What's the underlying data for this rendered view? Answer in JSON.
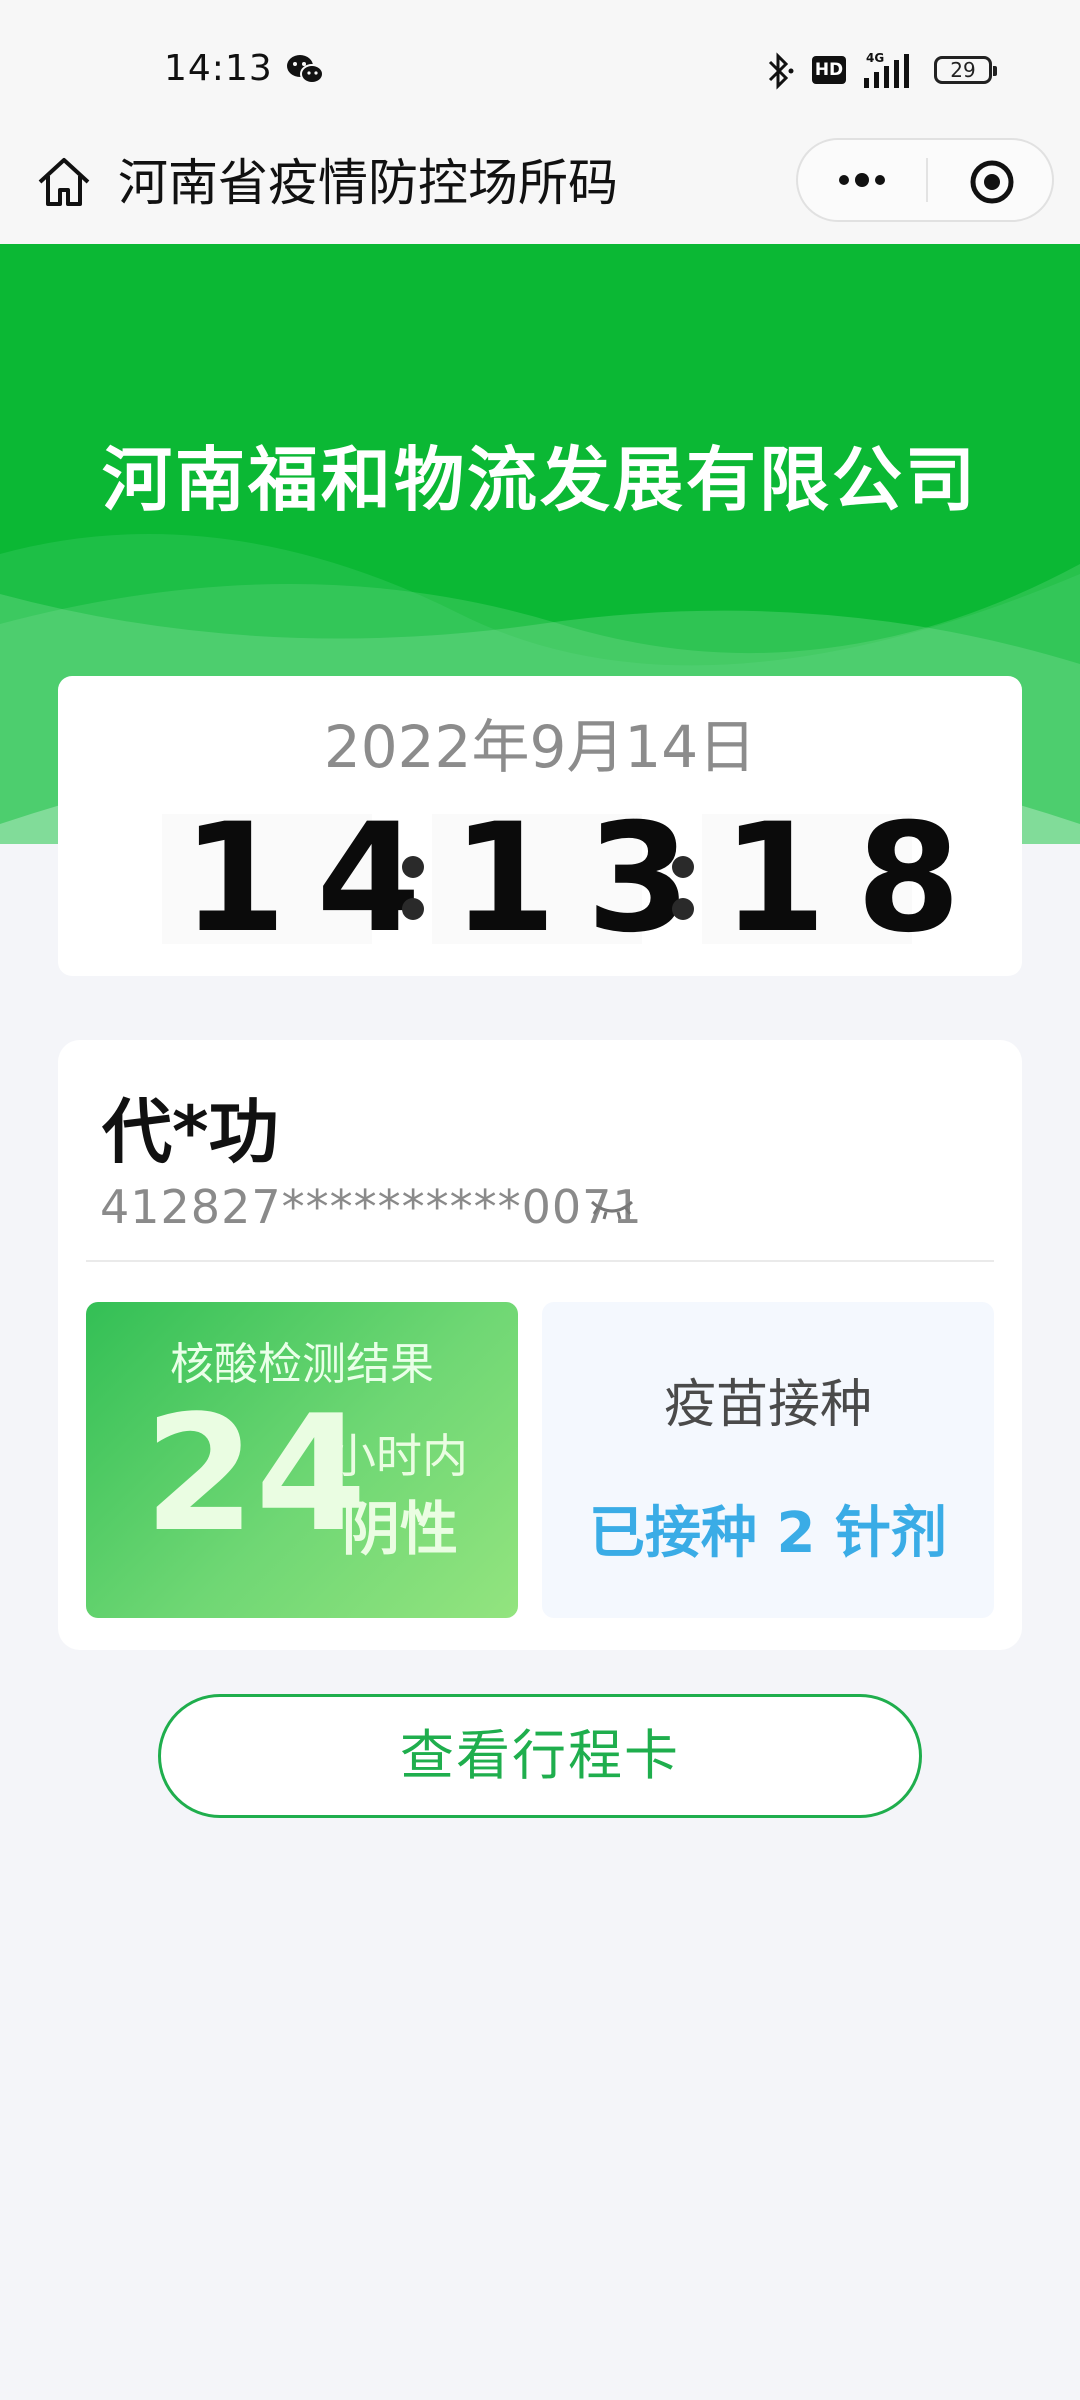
{
  "status_bar": {
    "time": "14:13",
    "network": "4G",
    "hd": "HD",
    "battery": "29"
  },
  "nav": {
    "title": "河南省疫情防控场所码",
    "home_icon": "home-icon",
    "more_icon": "more-dots-icon",
    "close_icon": "target-close-icon"
  },
  "hero": {
    "company_name": "河南福和物流发展有限公司",
    "color": "#0bb834"
  },
  "clock": {
    "date": "2022年9月14日",
    "hours": "14",
    "minutes": "13",
    "seconds": "18"
  },
  "person": {
    "name": "代*功",
    "id_number": "412827**********0071"
  },
  "nucleic": {
    "title": "核酸检测结果",
    "hours": "24",
    "unit": "小时内",
    "result": "阴性"
  },
  "vaccine": {
    "title": "疫苗接种",
    "status": "已接种 2 针剂",
    "status_color": "#3aace6"
  },
  "trip_button": {
    "label": "查看行程卡",
    "color": "#1fae4d"
  }
}
